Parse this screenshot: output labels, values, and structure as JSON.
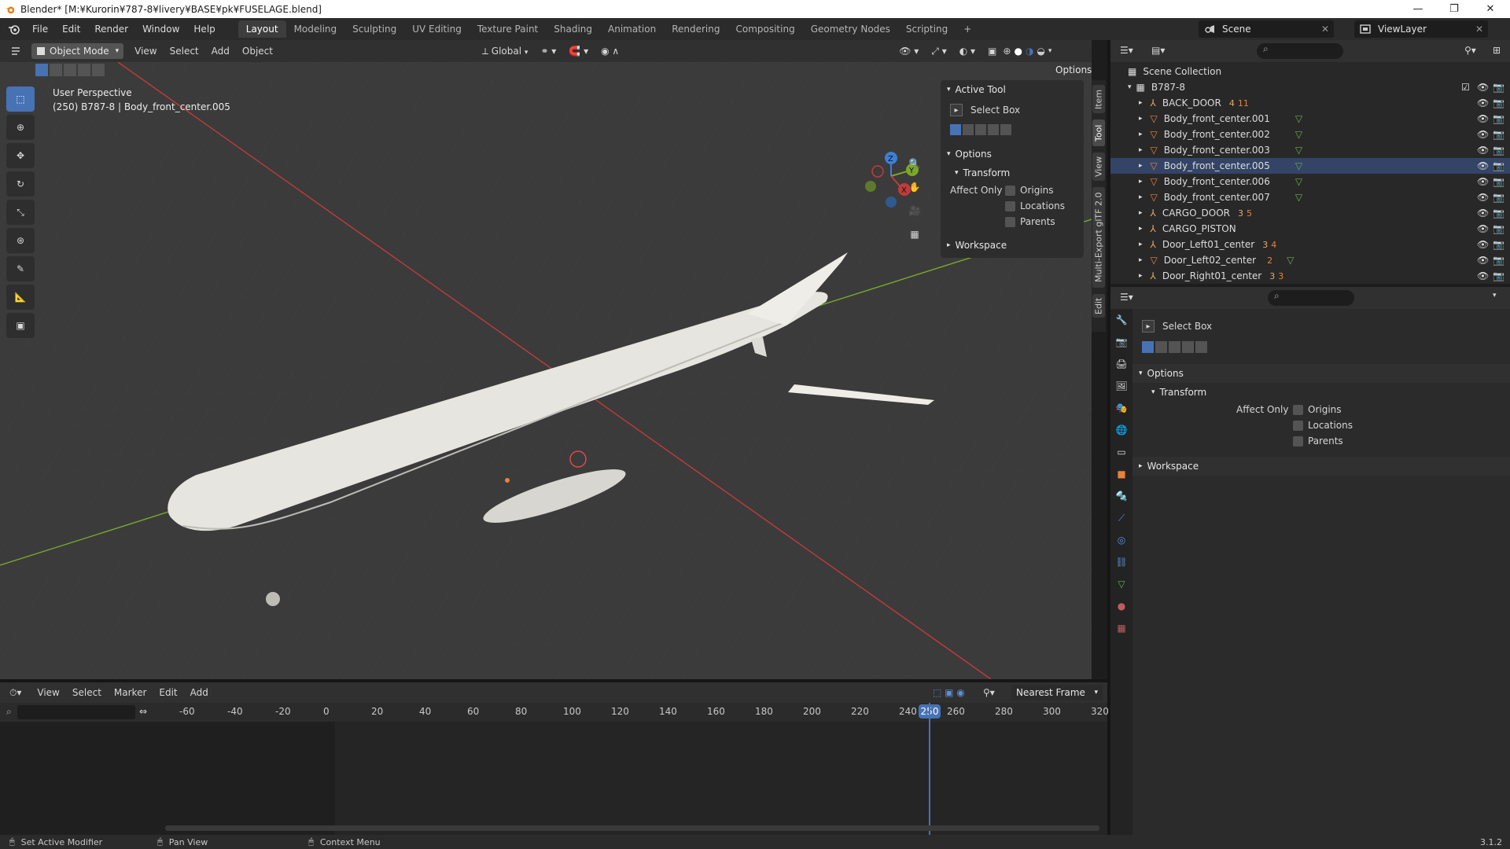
{
  "window": {
    "title": "Blender* [M:¥Kurorin¥787-8¥livery¥BASE¥pk¥FUSELAGE.blend]",
    "minimize": "—",
    "maximize": "❐",
    "close": "✕"
  },
  "menu": [
    "File",
    "Edit",
    "Render",
    "Window",
    "Help"
  ],
  "workspaces": [
    "Layout",
    "Modeling",
    "Sculpting",
    "UV Editing",
    "Texture Paint",
    "Shading",
    "Animation",
    "Rendering",
    "Compositing",
    "Geometry Nodes",
    "Scripting",
    "+"
  ],
  "scene": {
    "name": "Scene",
    "view_layer": "ViewLayer"
  },
  "viewport_header": {
    "mode": "Object Mode",
    "menus": [
      "View",
      "Select",
      "Add",
      "Object"
    ],
    "orientation": "Global",
    "options": "Options"
  },
  "viewport": {
    "perspective": "User Perspective",
    "info": "(250) B787-8 | Body_front_center.005",
    "gizmo_axes": [
      "Z",
      "Y",
      "X"
    ]
  },
  "sidebar_tabs": [
    "Item",
    "Tool",
    "View",
    "Multi-Export glTF 2.0",
    "Edit"
  ],
  "active_tool": {
    "header": "Active Tool",
    "name": "Select Box",
    "options_header": "Options",
    "transform_header": "Transform",
    "affect_only": "Affect Only",
    "checks": [
      "Origins",
      "Locations",
      "Parents"
    ],
    "workspace_header": "Workspace"
  },
  "outliner": {
    "root": "Scene Collection",
    "collection": "B787-8",
    "items": [
      {
        "name": "BACK_DOOR",
        "badge": "4",
        "badge2": "11"
      },
      {
        "name": "Body_front_center.001",
        "badge": "",
        "badge2": ""
      },
      {
        "name": "Body_front_center.002",
        "badge": "",
        "badge2": ""
      },
      {
        "name": "Body_front_center.003",
        "badge": "",
        "badge2": ""
      },
      {
        "name": "Body_front_center.005",
        "badge": "",
        "badge2": ""
      },
      {
        "name": "Body_front_center.006",
        "badge": "",
        "badge2": ""
      },
      {
        "name": "Body_front_center.007",
        "badge": "",
        "badge2": ""
      },
      {
        "name": "CARGO_DOOR",
        "badge": "3",
        "badge2": "5"
      },
      {
        "name": "CARGO_PISTON",
        "badge": "",
        "badge2": ""
      },
      {
        "name": "Door_Left01_center",
        "badge": "3",
        "badge2": "4"
      },
      {
        "name": "Door_Left02_center",
        "badge": "",
        "badge2": "2"
      },
      {
        "name": "Door_Right01_center",
        "badge": "3",
        "badge2": "3"
      }
    ]
  },
  "properties": {
    "tool_name": "Select Box",
    "options_header": "Options",
    "transform_header": "Transform",
    "affect_only": "Affect Only",
    "checks": [
      "Origins",
      "Locations",
      "Parents"
    ],
    "workspace_header": "Workspace"
  },
  "timeline": {
    "menus": [
      "View",
      "Select",
      "Marker",
      "Edit",
      "Add"
    ],
    "snap": "Nearest Frame",
    "ticks": [
      "-60",
      "-40",
      "-20",
      "0",
      "20",
      "40",
      "60",
      "80",
      "100",
      "120",
      "140",
      "160",
      "180",
      "200",
      "220",
      "240",
      "260",
      "280",
      "300",
      "320"
    ],
    "current_frame": "250"
  },
  "status": {
    "left": "Set Active Modifier",
    "middle": "Pan View",
    "right": "Context Menu",
    "version": "3.1.2"
  },
  "colors": {
    "accent": "#4772b3",
    "axis_x": "#c23b3b",
    "axis_y": "#7aa82b",
    "axis_z": "#3f7fd6",
    "orange": "#e8823a"
  }
}
